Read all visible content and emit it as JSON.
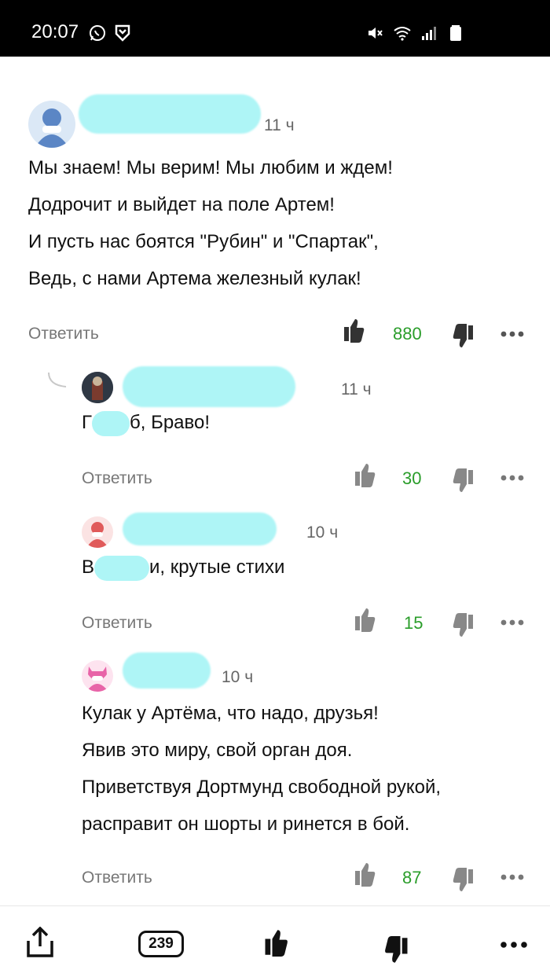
{
  "status_bar": {
    "time": "20:07"
  },
  "comments": [
    {
      "time": "11 ч",
      "lines": [
        "Мы знаем! Мы верим! Мы любим и ждем!",
        "Додрочит и выйдет на поле Артем!",
        "И пусть нас боятся \"Рубин\" и \"Спартак\",",
        "Ведь, с нами Артема железный кулак!"
      ],
      "reply_label": "Ответить",
      "likes": "880"
    },
    {
      "time": "11 ч",
      "text_suffix": "б, Браво!",
      "text_prefix_visible": "Г",
      "reply_label": "Ответить",
      "likes": "30"
    },
    {
      "time": "10 ч",
      "text_prefix_visible": "В",
      "text_suffix": "и, крутые стихи",
      "reply_label": "Ответить",
      "likes": "15"
    },
    {
      "time": "10 ч",
      "lines": [
        "Кулак у Артёма, что надо, друзья!",
        "Явив это миру, свой орган доя.",
        "Приветствуя Дортмунд свободной рукой,",
        "расправит он шорты и ринется в бой."
      ],
      "reply_label": "Ответить",
      "likes": "87"
    }
  ],
  "bottom_bar": {
    "comment_count": "239"
  },
  "colors": {
    "accent_green": "#2a9d2a",
    "blur": "#aef5f6",
    "muted": "#777777"
  },
  "icons": [
    "whatsapp-icon",
    "shield-icon",
    "mute-icon",
    "wifi-icon",
    "signal-icon",
    "battery-icon",
    "thumbs-up-icon",
    "thumbs-down-icon",
    "more-icon",
    "share-icon"
  ]
}
